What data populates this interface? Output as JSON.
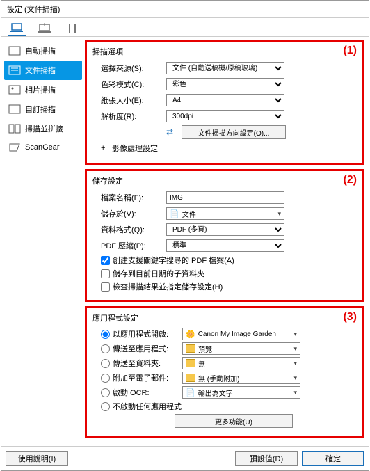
{
  "window_title": "設定 (文件掃描)",
  "sidebar": {
    "items": [
      {
        "label": "自動掃描"
      },
      {
        "label": "文件掃描"
      },
      {
        "label": "相片掃描"
      },
      {
        "label": "自訂掃描"
      },
      {
        "label": "掃描並拼接"
      },
      {
        "label": "ScanGear"
      }
    ]
  },
  "group1": {
    "marker": "(1)",
    "title": "掃描選項",
    "source_label": "選擇來源(S):",
    "source_value": "文件 (自動送稿機/原稿玻璃)",
    "color_label": "色彩模式(C):",
    "color_value": "彩色",
    "size_label": "紙張大小(E):",
    "size_value": "A4",
    "res_label": "解析度(R):",
    "res_value": "300dpi",
    "orient_btn": "文件掃描方向設定(O)...",
    "img_proc": "影像處理設定"
  },
  "group2": {
    "marker": "(2)",
    "title": "儲存設定",
    "fname_label": "檔案名稱(F):",
    "fname_value": "IMG",
    "saveto_label": "儲存於(V):",
    "saveto_value": "文件",
    "format_label": "資料格式(Q):",
    "format_value": "PDF (多頁)",
    "pdfcomp_label": "PDF 壓縮(P):",
    "pdfcomp_value": "標準",
    "chk1": "創建支援關鍵字搜尋的 PDF 檔案(A)",
    "chk2": "儲存到目前日期的子資料夾",
    "chk3": "檢查掃描結果並指定儲存設定(H)"
  },
  "group3": {
    "marker": "(3)",
    "title": "應用程式設定",
    "r1": "以應用程式開啟:",
    "r1_val": "Canon My Image Garden",
    "r2": "傳送至應用程式:",
    "r2_val": "預覽",
    "r3": "傳送至資料夾:",
    "r3_val": "無",
    "r4": "附加至電子郵件:",
    "r4_val": "無 (手動附加)",
    "r5": "啟動 OCR:",
    "r5_val": "輸出為文字",
    "r6": "不啟動任何應用程式",
    "more_btn": "更多功能(U)"
  },
  "footer": {
    "help": "使用說明(I)",
    "defaults": "預設值(D)",
    "ok": "確定"
  }
}
